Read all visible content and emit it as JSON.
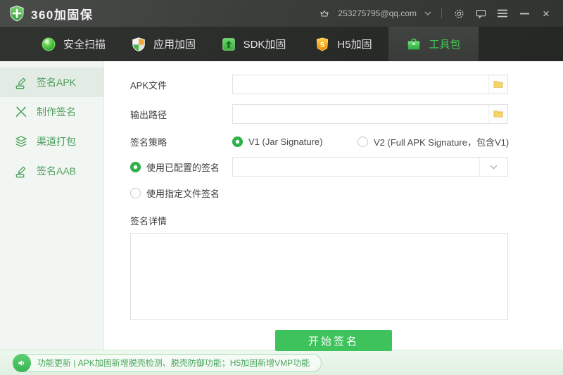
{
  "titlebar": {
    "app_title": "360加固保",
    "user_email": "253275795@qq.com"
  },
  "tabs": [
    {
      "label": "安全扫描",
      "icon": "scan-icon",
      "active": false
    },
    {
      "label": "应用加固",
      "icon": "app-shield-icon",
      "active": false
    },
    {
      "label": "SDK加固",
      "icon": "sdk-upload-icon",
      "active": false
    },
    {
      "label": "H5加固",
      "icon": "h5-shield-icon",
      "active": false
    },
    {
      "label": "工具包",
      "icon": "toolbox-icon",
      "active": true
    }
  ],
  "sidebar": {
    "items": [
      {
        "label": "签名APK",
        "icon": "sign-apk-icon",
        "active": true
      },
      {
        "label": "制作签名",
        "icon": "make-signature-icon",
        "active": false
      },
      {
        "label": "渠道打包",
        "icon": "channel-package-icon",
        "active": false
      },
      {
        "label": "签名AAB",
        "icon": "sign-aab-icon",
        "active": false
      }
    ]
  },
  "form": {
    "apk_file": {
      "label": "APK文件",
      "value": ""
    },
    "output_path": {
      "label": "输出路径",
      "value": ""
    },
    "strategy": {
      "label": "签名策略",
      "options": [
        {
          "label": "V1 (Jar Signature)",
          "selected": true
        },
        {
          "label": "V2 (Full APK Signature，包含V1)",
          "selected": false
        }
      ]
    },
    "use_configured": {
      "label": "使用已配置的签名",
      "selected": true,
      "value": ""
    },
    "use_file": {
      "label": "使用指定文件签名",
      "selected": false
    },
    "detail": {
      "label": "签名详情",
      "value": ""
    },
    "submit_label": "开始签名"
  },
  "statusbar": {
    "text": "功能更新 | APK加固新增脱壳检测、脱壳防御功能；H5加固新增VMP功能"
  },
  "colors": {
    "accent_green": "#3ec25b",
    "tab_active_green": "#3fc654",
    "titlebar_bg": "#3c3e3c",
    "tabbar_bg": "#2a2c2a",
    "sidebar_bg": "#f2f6f2",
    "status_text_green": "#4aa55c",
    "h5_orange": "#f08c00"
  }
}
